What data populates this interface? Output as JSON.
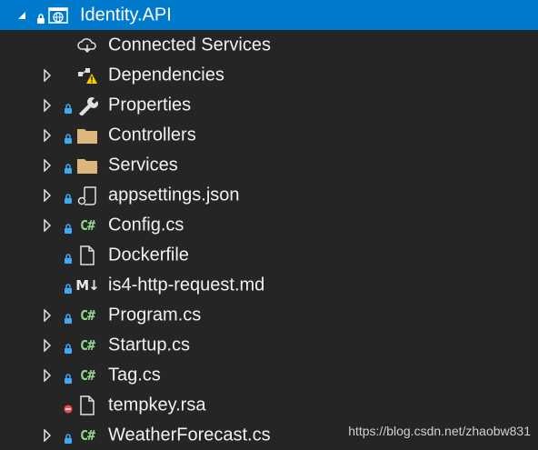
{
  "solution_explorer": {
    "project": {
      "label": "Identity.API",
      "expanded": true,
      "selected": true,
      "icon": "web-project-icon"
    },
    "items": [
      {
        "label": "Connected Services",
        "icon": "cloud-connected-icon",
        "expander": false,
        "lock": "none"
      },
      {
        "label": "Dependencies",
        "icon": "dependencies-warning-icon",
        "expander": true,
        "lock": "none"
      },
      {
        "label": "Properties",
        "icon": "wrench-icon",
        "expander": true,
        "lock": "blue"
      },
      {
        "label": "Controllers",
        "icon": "folder-icon",
        "expander": true,
        "lock": "blue"
      },
      {
        "label": "Services",
        "icon": "folder-icon",
        "expander": true,
        "lock": "blue"
      },
      {
        "label": "appsettings.json",
        "icon": "json-file-icon",
        "expander": true,
        "lock": "blue"
      },
      {
        "label": "Config.cs",
        "icon": "csharp-icon",
        "expander": true,
        "lock": "blue"
      },
      {
        "label": "Dockerfile",
        "icon": "file-icon",
        "expander": false,
        "lock": "blue"
      },
      {
        "label": "is4-http-request.md",
        "icon": "markdown-icon",
        "expander": false,
        "lock": "blue"
      },
      {
        "label": "Program.cs",
        "icon": "csharp-icon",
        "expander": true,
        "lock": "blue"
      },
      {
        "label": "Startup.cs",
        "icon": "csharp-icon",
        "expander": true,
        "lock": "blue"
      },
      {
        "label": "Tag.cs",
        "icon": "csharp-icon",
        "expander": true,
        "lock": "blue"
      },
      {
        "label": "tempkey.rsa",
        "icon": "file-icon",
        "expander": false,
        "lock": "excluded-red"
      },
      {
        "label": "WeatherForecast.cs",
        "icon": "csharp-icon",
        "expander": true,
        "lock": "blue"
      }
    ]
  },
  "icon_text": {
    "csharp": "C#",
    "markdown": "M↓"
  },
  "watermark": "https://blog.csdn.net/zhaobw831",
  "colors": {
    "background": "#252526",
    "selection": "#007acc",
    "lock": "#3fa9f5",
    "excluded": "#f14c4c",
    "folder": "#dcb67a"
  }
}
